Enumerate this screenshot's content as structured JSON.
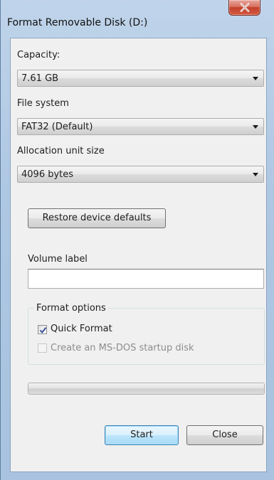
{
  "window": {
    "title": "Format Removable Disk (D:)"
  },
  "capacity": {
    "label": "Capacity:",
    "value": "7.61 GB"
  },
  "file_system": {
    "label": "File system",
    "value": "FAT32 (Default)"
  },
  "allocation": {
    "label": "Allocation unit size",
    "value": "4096 bytes"
  },
  "restore_button": {
    "label": "Restore device defaults"
  },
  "volume_label": {
    "label": "Volume label",
    "value": ""
  },
  "format_options": {
    "title": "Format options",
    "quick_format": {
      "label": "Quick Format",
      "checked": true,
      "enabled": true
    },
    "msdos_startup": {
      "label": "Create an MS-DOS startup disk",
      "checked": false,
      "enabled": false
    }
  },
  "progress": {
    "value": 0
  },
  "buttons": {
    "start": "Start",
    "close": "Close"
  },
  "colors": {
    "title_bar": "#bfd4ea",
    "client_bg": "#f0f0f0",
    "close_button": "#c2402c",
    "default_button_border": "#3c7fb1"
  },
  "icons": {
    "close": "close-x-icon",
    "dropdown": "chevron-down-icon",
    "check": "check-icon"
  }
}
